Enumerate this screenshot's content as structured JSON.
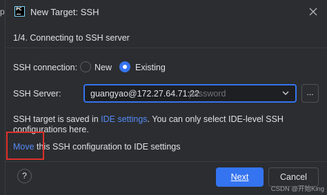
{
  "left_edge": {
    "text": "p"
  },
  "window": {
    "title": "New Target: SSH",
    "logo_text": "PC"
  },
  "step": {
    "text": "1/4. Connecting to SSH server"
  },
  "ssh_connection": {
    "label": "SSH connection:",
    "options": [
      {
        "label": "New",
        "selected": false
      },
      {
        "label": "Existing",
        "selected": true
      }
    ]
  },
  "ssh_server": {
    "label": "SSH Server:",
    "value": "guangyao@172.27.64.71:22",
    "hint": "password",
    "browse_label": "..."
  },
  "info": {
    "prefix": "SSH target is saved in ",
    "link": "IDE settings",
    "suffix": ". You can only select IDE-level SSH configurations here."
  },
  "move": {
    "link": "Move",
    "text": " this SSH configuration to IDE settings"
  },
  "footer": {
    "help_label": "?",
    "next_label": "Next",
    "cancel_label": "Cancel"
  },
  "watermark": "CSDN @开始King",
  "colors": {
    "accent": "#3574f0",
    "link": "#548af7",
    "highlight_box": "#e0302a",
    "background": "#2b2d30"
  }
}
